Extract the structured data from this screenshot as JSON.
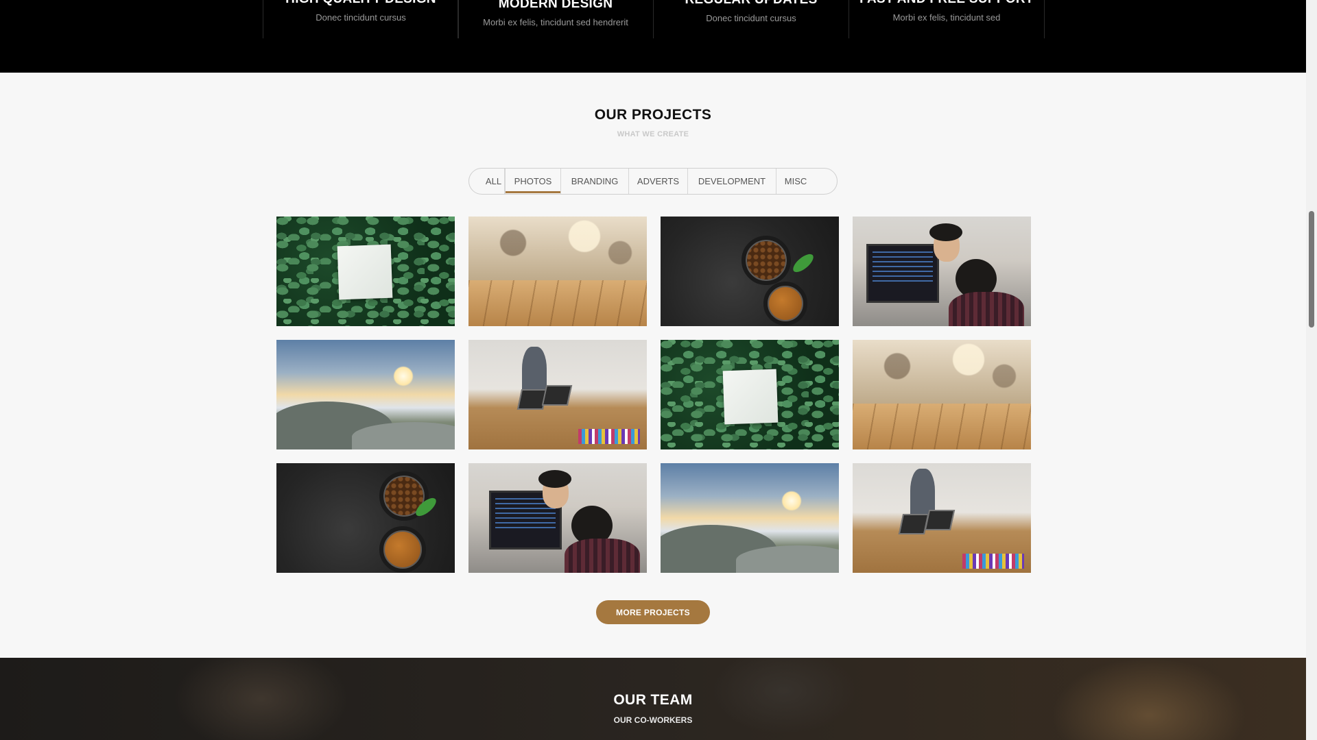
{
  "features": [
    {
      "title": "HIGH QUALITY DESIGN",
      "desc": "Donec tincidunt cursus"
    },
    {
      "title": "MODERN DESIGN",
      "desc": "Morbi ex felis, tincidunt sed hendrerit"
    },
    {
      "title": "REGULAR UPDATES",
      "desc": "Donec tincidunt cursus"
    },
    {
      "title": "FAST AND FREE SUPPORT",
      "desc": "Morbi ex felis, tincidunt sed"
    }
  ],
  "projects": {
    "title": "OUR PROJECTS",
    "subtitle": "WHAT WE CREATE",
    "filters": [
      "ALL",
      "PHOTOS",
      "BRANDING",
      "ADVERTS",
      "DEVELOPMENT",
      "MISC"
    ],
    "active_filter": "PHOTOS",
    "accent_color": "#a5783f",
    "more_label": "MORE PROJECTS"
  },
  "team": {
    "title": "OUR TEAM",
    "subtitle": "OUR CO-WORKERS"
  }
}
